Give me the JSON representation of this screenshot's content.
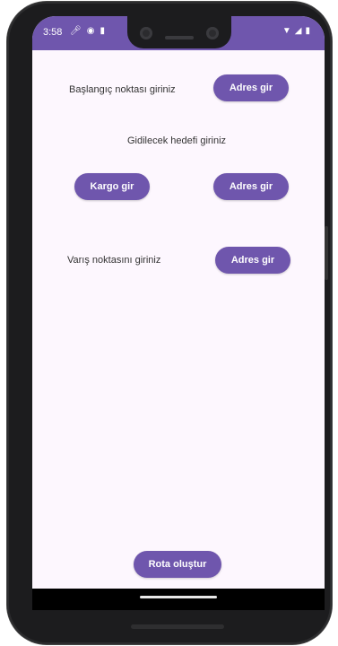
{
  "status_bar": {
    "time": "3:58",
    "left_icons": [
      "mic-icon",
      "game-icon",
      "sim-icon"
    ],
    "right_icons": [
      "wifi-icon",
      "signal-icon",
      "battery-icon"
    ],
    "color": "#6f56ad"
  },
  "form": {
    "start_label": "Başlangıç noktası giriniz",
    "start_button": "Adres gir",
    "target_label": "Gidilecek hedefi giriniz",
    "cargo_button": "Kargo gir",
    "target_button": "Adres gir",
    "destination_label": "Varış noktasını giriniz",
    "destination_button": "Adres gir"
  },
  "footer": {
    "create_route_button": "Rota oluştur"
  },
  "colors": {
    "accent": "#6f56ad",
    "background": "#fdf7fe"
  }
}
